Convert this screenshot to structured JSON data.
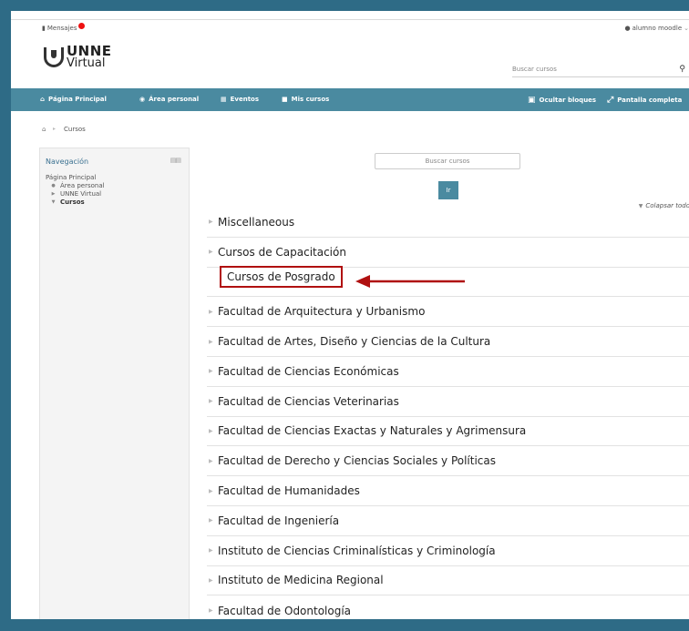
{
  "header": {
    "messages_label": "Mensajes",
    "user_label": "alumno moodle",
    "logo_line1": "UNNE",
    "logo_line2": "Virtual",
    "search_placeholder": "Buscar cursos"
  },
  "navbar": {
    "items": [
      {
        "label": "Página Principal",
        "icon": "home-icon"
      },
      {
        "label": "Área personal",
        "icon": "dashboard-icon"
      },
      {
        "label": "Eventos",
        "icon": "calendar-icon"
      },
      {
        "label": "Mis cursos",
        "icon": "courses-icon"
      }
    ],
    "hide_blocks_label": "Ocultar bloques",
    "fullscreen_label": "Pantalla completa"
  },
  "breadcrumb": {
    "current": "Cursos"
  },
  "sidebar": {
    "title": "Navegación",
    "items": [
      {
        "label": "Página Principal"
      },
      {
        "label": "Área personal"
      },
      {
        "label": "UNNE Virtual"
      },
      {
        "label": "Cursos"
      }
    ]
  },
  "main": {
    "search_placeholder": "Buscar cursos",
    "go_button": "Ir",
    "collapse_all": "Colapsar todo",
    "categories": [
      "Miscellaneous",
      "Cursos de Capacitación",
      "Cursos de Posgrado",
      "Facultad de Arquitectura y Urbanismo",
      "Facultad de Artes, Diseño y Ciencias de la Cultura",
      "Facultad de Ciencias Económicas",
      "Facultad de Ciencias Veterinarias",
      "Facultad de Ciencias Exactas y Naturales y Agrimensura",
      "Facultad de Derecho y Ciencias Sociales y Políticas",
      "Facultad de Humanidades",
      "Facultad de Ingeniería",
      "Instituto de Ciencias Criminalísticas y Criminología",
      "Instituto de Medicina Regional",
      "Facultad de Odontología"
    ],
    "highlighted_category": "Cursos de Posgrado"
  },
  "colors": {
    "accent": "#4a8aa0",
    "highlight": "#b01010",
    "frame": "#2e6b86"
  }
}
